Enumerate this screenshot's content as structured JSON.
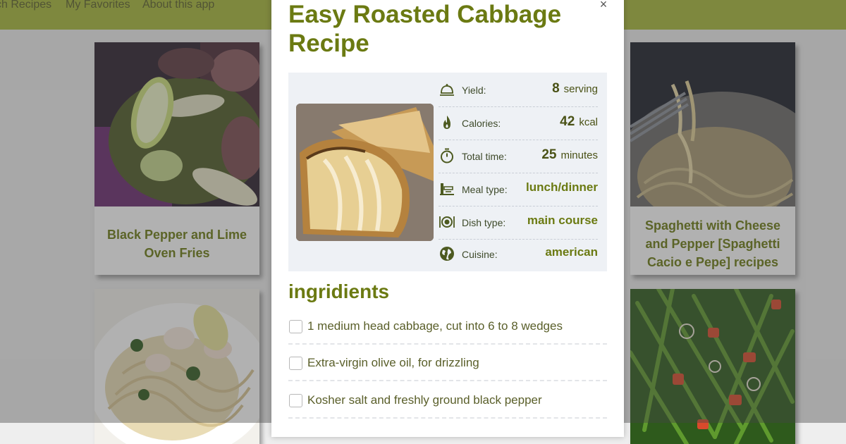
{
  "nav": {
    "links": [
      "ch Recipes",
      "My Favorites",
      "About this app"
    ]
  },
  "cards": [
    {
      "title": "Black Pepper and Lime Oven Fries"
    },
    {
      "title": "Spaghetti with Cheese and Pepper [Spaghetti Cacio e Pepe] recipes"
    }
  ],
  "modal": {
    "close_icon": "×",
    "title": "Easy Roasted Cabbage Recipe",
    "info": {
      "yield": {
        "label": "Yield:",
        "value": "8",
        "unit": "serving"
      },
      "calories": {
        "label": "Calories:",
        "value": "42",
        "unit": "kcal"
      },
      "total_time": {
        "label": "Total time:",
        "value": "25",
        "unit": "minutes"
      },
      "meal_type": {
        "label": "Meal type:",
        "value": "lunch/dinner"
      },
      "dish_type": {
        "label": "Dish type:",
        "value": "main course"
      },
      "cuisine": {
        "label": "Cuisine:",
        "value": "american"
      }
    },
    "ingredients_title": "ingridients",
    "ingredients": [
      "1 medium head cabbage, cut into 6 to 8 wedges",
      "Extra-virgin olive oil, for drizzling",
      "Kosher salt and freshly ground black pepper"
    ]
  },
  "colors": {
    "navbar": "#a8b83a",
    "title_green": "#6b7a12",
    "panel_bg": "#eef1f5"
  },
  "icons": [
    "cloche-icon",
    "flame-icon",
    "stopwatch-icon",
    "chef-stove-icon",
    "plate-cutlery-icon",
    "globe-icon",
    "close-icon"
  ]
}
